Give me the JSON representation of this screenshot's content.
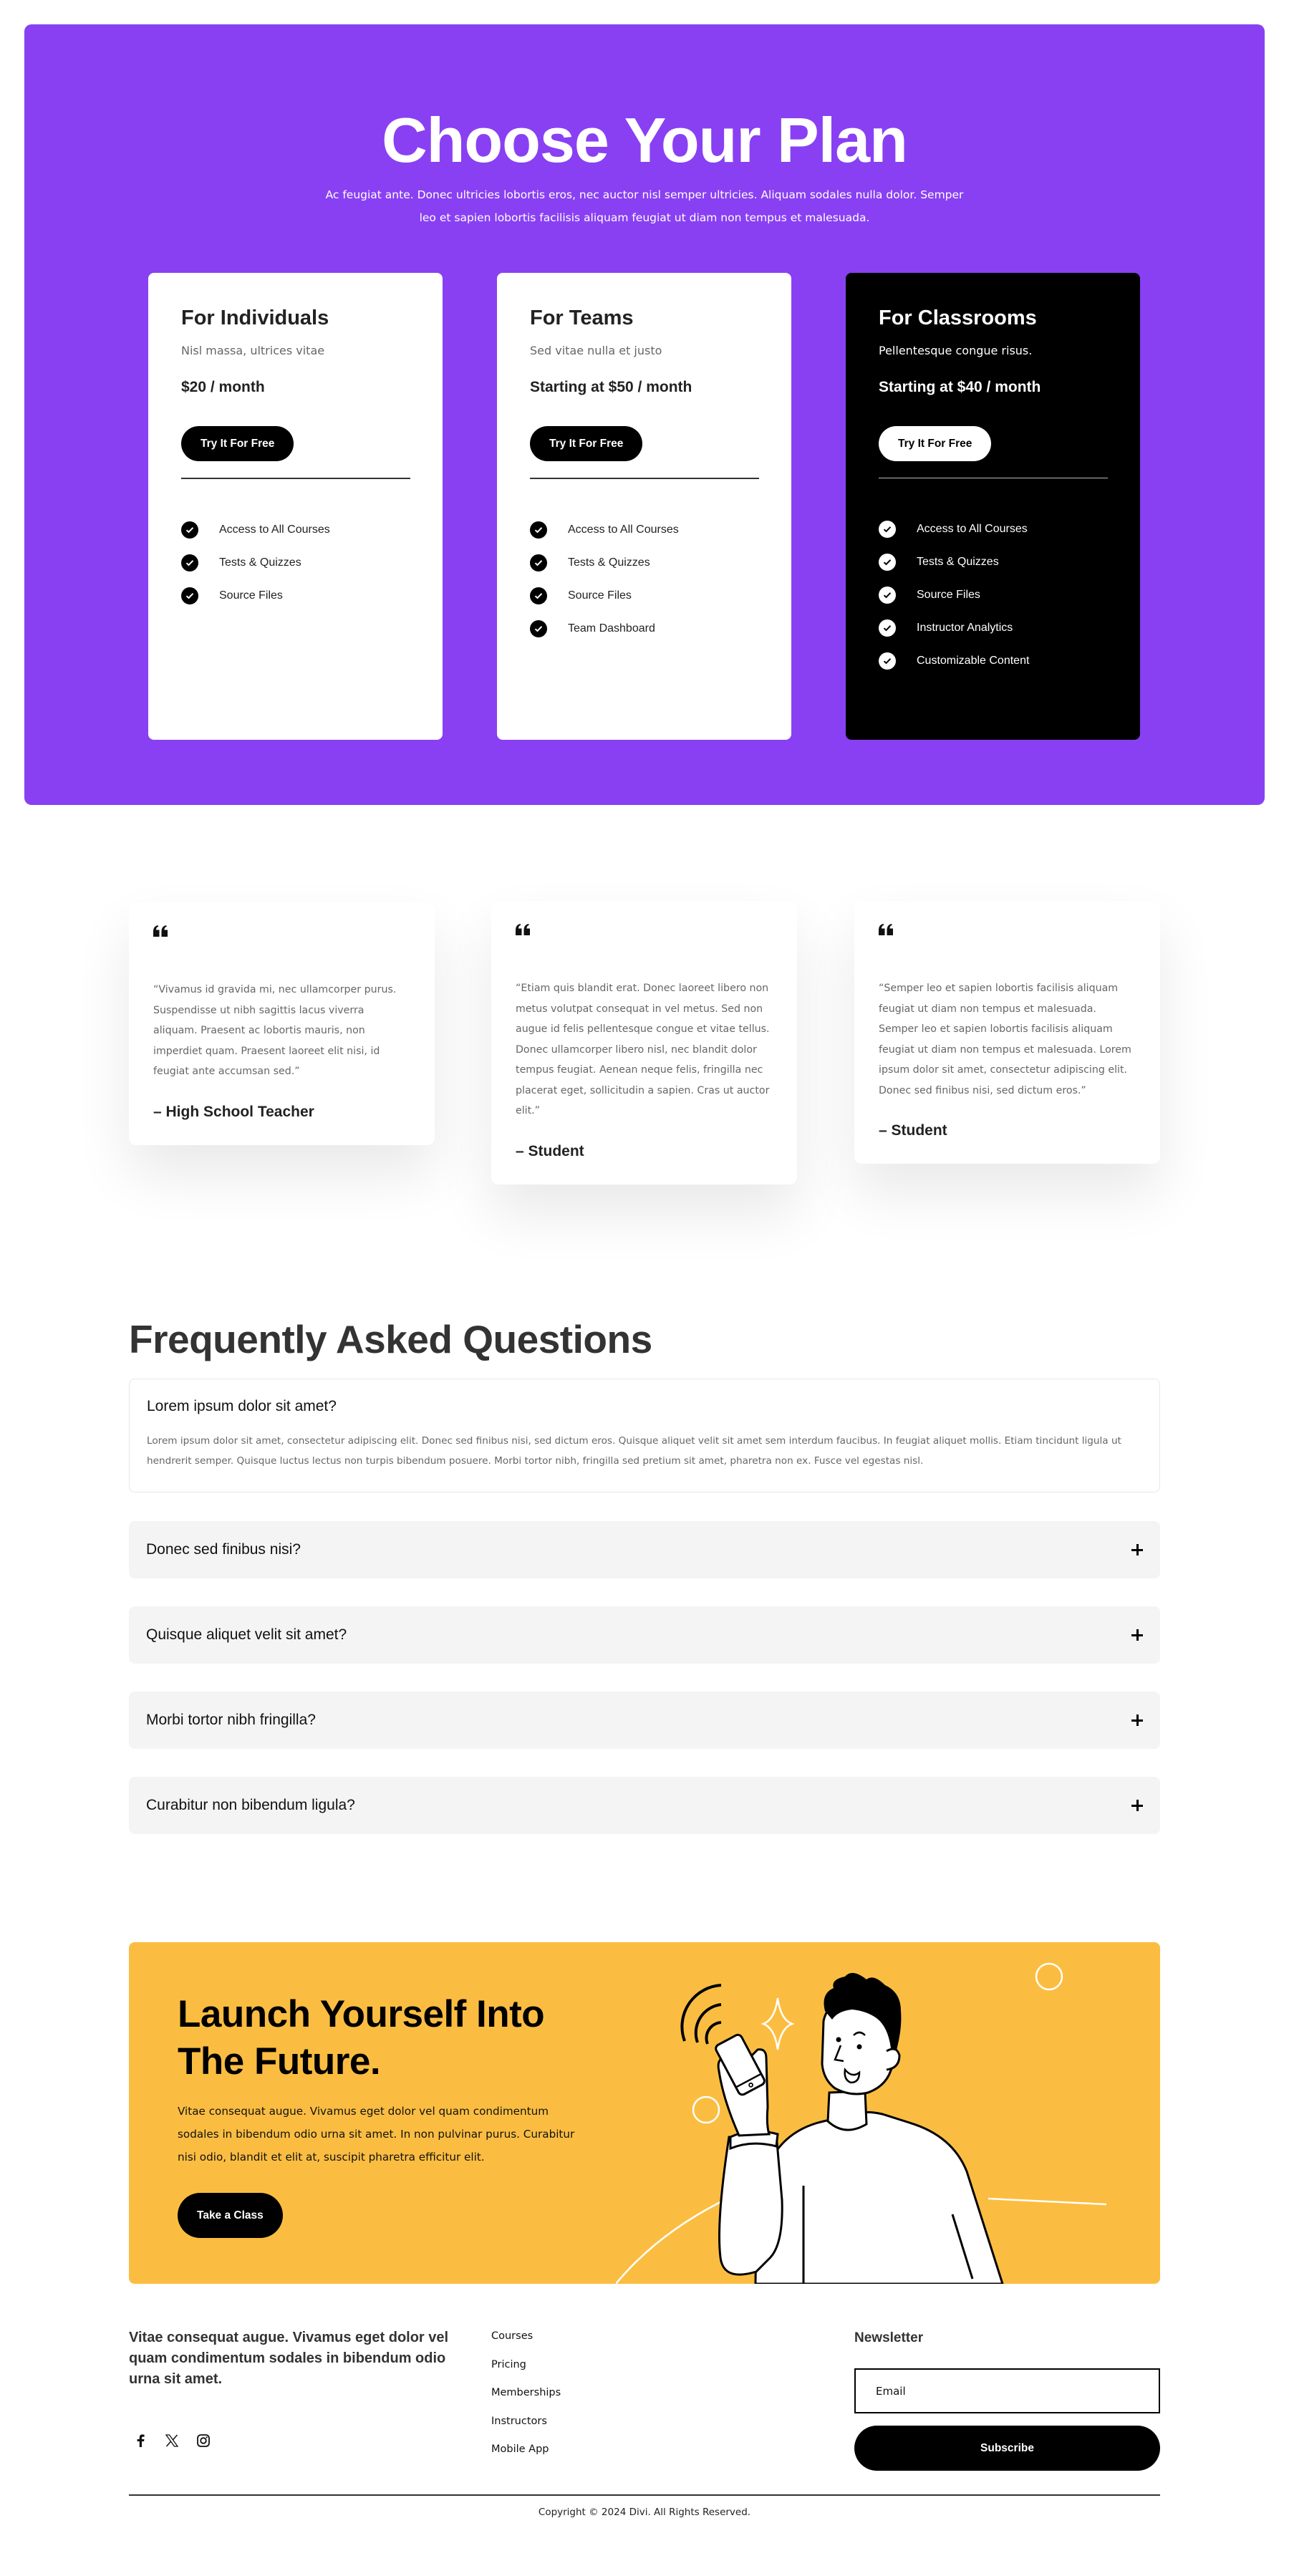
{
  "colors": {
    "hero_bg": "#8940f3",
    "cta_bg": "#fbbd41",
    "faq_closed_bg": "#f4f4f4",
    "dark_card_bg": "#000000"
  },
  "pricing": {
    "title": "Choose Your Plan",
    "subtitle": "Ac feugiat ante. Donec ultricies lobortis eros, nec auctor nisl semper ultricies. Aliquam sodales nulla dolor. Semper leo et sapien lobortis facilisis aliquam feugiat ut diam non tempus et malesuada.",
    "plans": [
      {
        "title": "For Individuals",
        "tagline": "Nisl massa, ultrices vitae",
        "price": "$20 / month",
        "button": "Try It For Free",
        "features": [
          "Access to All Courses",
          "Tests & Quizzes",
          "Source Files"
        ]
      },
      {
        "title": "For Teams",
        "tagline": "Sed vitae nulla et justo",
        "price": "Starting at $50 / month",
        "button": "Try It For Free",
        "features": [
          "Access to All Courses",
          "Tests & Quizzes",
          "Source Files",
          "Team Dashboard"
        ]
      },
      {
        "title": "For Classrooms",
        "tagline": "Pellentesque congue risus.",
        "price": "Starting at $40 / month",
        "button": "Try It For Free",
        "features": [
          "Access to All Courses",
          "Tests & Quizzes",
          "Source Files",
          "Instructor Analytics",
          "Customizable Content"
        ]
      }
    ]
  },
  "testimonials": [
    {
      "quote_icon": "quote-icon",
      "body": "“Vivamus id gravida mi, nec ullamcorper purus. Suspendisse ut nibh sagittis lacus viverra aliquam. Praesent ac lobortis mauris, non imperdiet quam. Praesent laoreet elit nisi, id feugiat ante accumsan sed.”",
      "author": "– High School Teacher"
    },
    {
      "quote_icon": "quote-icon",
      "body": "“Etiam quis blandit erat. Donec laoreet libero non metus volutpat consequat in vel metus. Sed non augue id felis pellentesque congue et vitae tellus. Donec ullamcorper libero nisl, nec blandit dolor tempus feugiat. Aenean neque felis, fringilla nec placerat eget, sollicitudin a sapien. Cras ut auctor elit.”",
      "author": "– Student"
    },
    {
      "quote_icon": "quote-icon",
      "body": "“Semper leo et sapien lobortis facilisis aliquam feugiat ut diam non tempus et malesuada. Semper leo et sapien lobortis facilisis aliquam feugiat ut diam non tempus et malesuada. Lorem ipsum dolor sit amet, consectetur adipiscing elit. Donec sed finibus nisi, sed dictum eros.”",
      "author": "– Student"
    }
  ],
  "faq": {
    "title": "Frequently Asked Questions",
    "items": [
      {
        "question": "Lorem ipsum dolor sit amet?",
        "answer": "Lorem ipsum dolor sit amet, consectetur adipiscing elit. Donec sed finibus nisi, sed dictum eros. Quisque aliquet velit sit amet sem interdum faucibus. In feugiat aliquet mollis. Etiam tincidunt ligula ut hendrerit semper. Quisque luctus lectus non turpis bibendum posuere. Morbi tortor nibh, fringilla sed pretium sit amet, pharetra non ex. Fusce vel egestas nisl.",
        "open": true
      },
      {
        "question": "Donec sed finibus nisi?",
        "open": false,
        "icon": "plus-icon"
      },
      {
        "question": "Quisque aliquet velit sit amet?",
        "open": false,
        "icon": "plus-icon"
      },
      {
        "question": "Morbi tortor nibh fringilla?",
        "open": false,
        "icon": "plus-icon"
      },
      {
        "question": "Curabitur non bibendum ligula?",
        "open": false,
        "icon": "plus-icon"
      }
    ]
  },
  "cta": {
    "title_line1": "Launch Yourself Into",
    "title_line2": "The Future.",
    "body": "Vitae consequat augue. Vivamus eget dolor vel quam condimentum sodales in bibendum odio urna sit amet. In non pulvinar purus. Curabitur nisi odio, blandit et elit at, suscipit pharetra efficitur elit.",
    "button": "Take a Class",
    "illustration": "man-holding-phone-illustration"
  },
  "footer": {
    "about": "Vitae consequat augue. Vivamus eget dolor vel quam condimentum sodales in bibendum odio urna sit amet.",
    "socials": [
      "facebook-icon",
      "x-icon",
      "instagram-icon"
    ],
    "links": [
      "Courses",
      "Pricing",
      "Memberships",
      "Instructors",
      "Mobile App"
    ],
    "newsletter": {
      "title": "Newsletter",
      "email_placeholder": "Email",
      "email_value": "",
      "button": "Subscribe"
    },
    "copyright": "Copyright © 2024 Divi. All Rights Reserved."
  }
}
